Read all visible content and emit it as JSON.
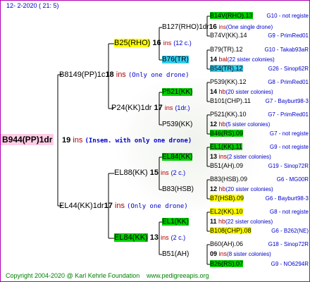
{
  "header": {
    "date": "12-  2-2020 ( 21:  5)"
  },
  "footer": {
    "copyright": "Copyright 2004-2020 @ Karl Kehrle Foundation",
    "site": "www.pedigreeapis.org"
  },
  "root": {
    "name": "B944(PP)1dr",
    "gen": "19",
    "ins": "ins",
    "note": "(Insem. with only one drone)"
  },
  "gen2": [
    {
      "name": "B8149(PP)1c",
      "gen": "18",
      "ins": "ins",
      "note": "(Only one drone)"
    },
    {
      "name": "EL44(KK)1dr",
      "gen": "17",
      "ins": "ins",
      "note": "(Only one drone)"
    }
  ],
  "gen3": [
    {
      "name": "B25(RHO)",
      "gen": "16",
      "ins": "ins",
      "note": "(12 c.)"
    },
    {
      "name": "P24(KK)1dr",
      "gen": "17",
      "ins": "ins",
      "note": "(1dr.)"
    },
    {
      "name": "EL88(KK)",
      "gen": "15",
      "ins": "ins",
      "note": "(2 c.)"
    },
    {
      "name": "EL84(KK)",
      "gen": "13",
      "ins": "ins",
      "note": "(2 c.)"
    }
  ],
  "gen4": [
    {
      "name": "B127(RHO)1dr",
      "gen": "16",
      "ins": "ins",
      "note": "(One single drone)"
    },
    {
      "name": "B76(TR)",
      "gen": "14",
      "ins": "bal",
      "note": "(22 sister colonies)"
    },
    {
      "name": "P521(KK)",
      "gen": "14",
      "ins": "hb",
      "note": "(20 sister colonies)"
    },
    {
      "name": "P539(KK)",
      "gen": "12",
      "ins": "hb",
      "note": "(5 sister colonies)"
    },
    {
      "name": "EL84(KK)",
      "gen": "13",
      "ins": "ins",
      "note": "(2 sister colonies)"
    },
    {
      "name": "B83(HSB)",
      "gen": "12",
      "ins": "hb",
      "note": "(20 sister colonies)"
    },
    {
      "name": "EL1(KK)",
      "gen": "11",
      "ins": "hb",
      "note": "(22 sister colonies)"
    },
    {
      "name": "B51(AH)",
      "gen": "09",
      "ins": "ins",
      "note": "(8 sister colonies)"
    }
  ],
  "gen5": [
    {
      "name": "B14V(RHO).13",
      "ped": "G10 - not registe"
    },
    {
      "name": "B74V(KK).14",
      "ped": "G9 - PrimRed01"
    },
    {
      "name": "B79(TR).12",
      "ped": "G10 - Takab93aR"
    },
    {
      "name": "B54(TR).12",
      "ped": "G26 - Sinop62R"
    },
    {
      "name": "P539(KK).12",
      "ped": "G8 - PrimRed01"
    },
    {
      "name": "B101(CHP).11",
      "ped": "G7 - Bayburt98-3"
    },
    {
      "name": "P521(KK).10",
      "ped": "G7 - PrimRed01"
    },
    {
      "name": "B46(RS).09",
      "ped": "G7 - not registe"
    },
    {
      "name": "EL1(KK).11",
      "ped": "G9 - not registe"
    },
    {
      "name": "B51(AH).09",
      "ped": "G19 - Sinop72R"
    },
    {
      "name": "B83(HSB).09",
      "ped": "G6 - MG00R"
    },
    {
      "name": "B7(HSB).09",
      "ped": "G6 - Bayburt98-3"
    },
    {
      "name": "EL2(KK).10",
      "ped": "G8 - not registe"
    },
    {
      "name": "B108(CHP).08",
      "ped": "G6 - B262(NE)"
    },
    {
      "name": "B60(AH).06",
      "ped": "G18 - Sinop72R"
    },
    {
      "name": "B26(RS).07",
      "ped": "G9 - NO6294R"
    }
  ],
  "colors": {
    "frame": "#b000b0",
    "root_bg": "#ffcce6",
    "yellow": "#ffff00",
    "green": "#00cc00",
    "cyan": "#33ccee",
    "ins": "#b00000",
    "note": "#0000cc"
  }
}
